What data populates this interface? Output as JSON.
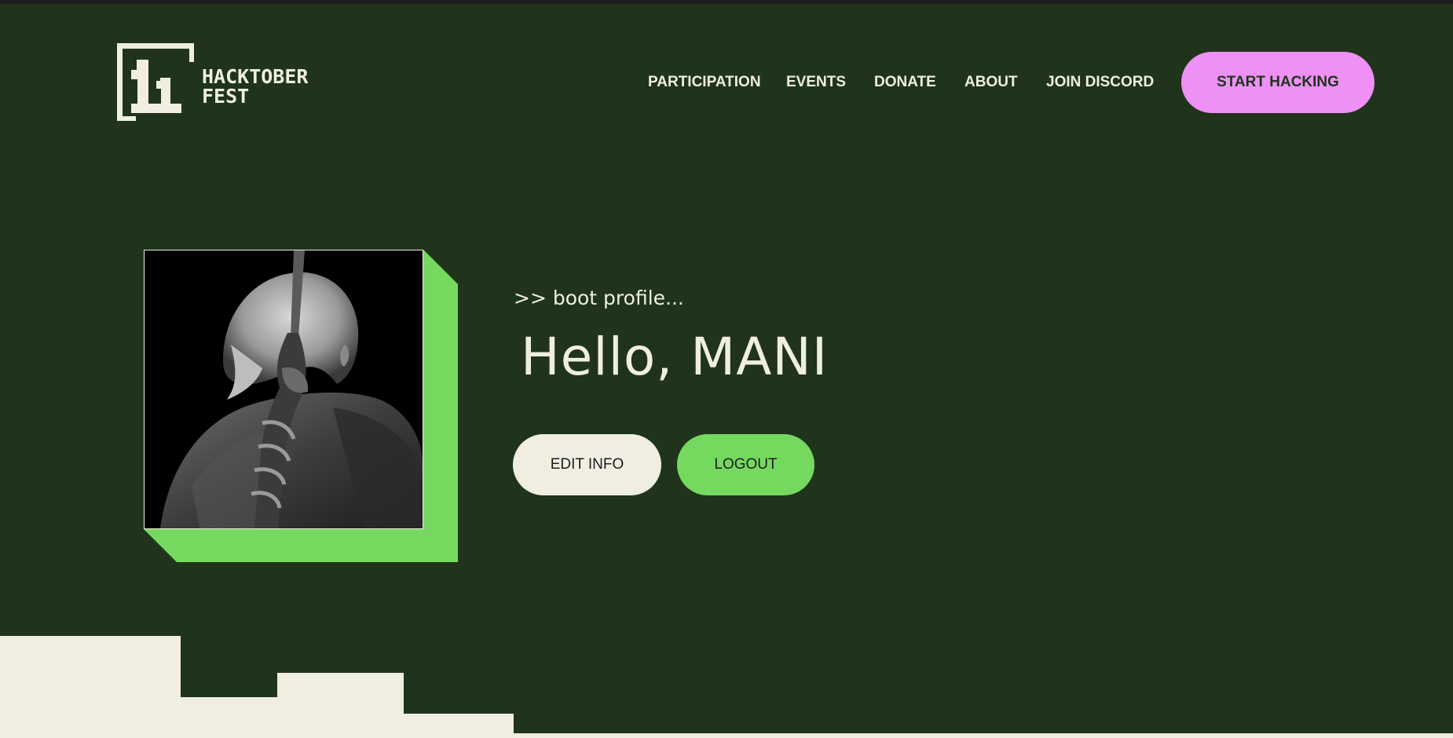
{
  "header": {
    "logo_text_line1": "HACKTOBER",
    "logo_text_line2": "FEST",
    "nav": [
      {
        "label": "PARTICIPATION"
      },
      {
        "label": "EVENTS"
      },
      {
        "label": "DONATE"
      },
      {
        "label": "ABOUT"
      },
      {
        "label": "JOIN DISCORD"
      }
    ],
    "cta_label": "START HACKING"
  },
  "profile": {
    "boot_text": ">> boot profile...",
    "greeting": "Hello, MANI",
    "edit_label": "EDIT INFO",
    "logout_label": "LOGOUT"
  },
  "colors": {
    "background": "#1f341b",
    "cream": "#efeee1",
    "green_accent": "#75d960",
    "pink_accent": "#ee90f6",
    "dark": "#1b1d1f"
  },
  "icons": {
    "logo": "hacktoberfest-11-logo-icon",
    "avatar": "user-avatar-icon"
  }
}
